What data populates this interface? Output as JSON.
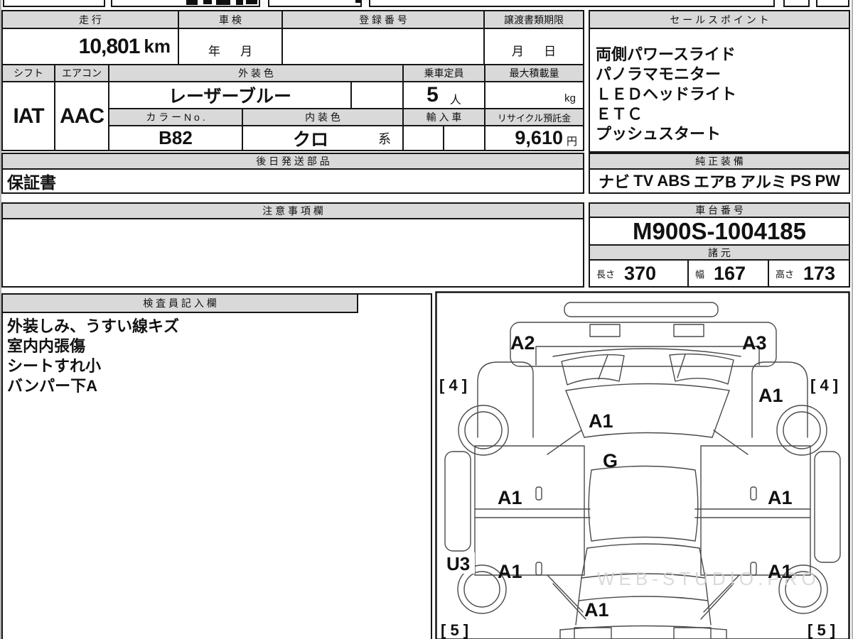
{
  "colors": {
    "header_fill": "#d9d9d9",
    "border": "#161616",
    "watermark_gray": "#d2d2d2"
  },
  "header_row": {
    "mileage_label": "走 行",
    "mileage_value": "10,801",
    "mileage_unit": "km",
    "shaken_label": "車 検",
    "shaken_value": "年      月",
    "registration_label": "登 録 番 号",
    "registration_value": "",
    "transfer_label": "譲渡書類期限",
    "transfer_value": "月      日"
  },
  "spec": {
    "shift_label": "シフト",
    "shift_value": "IAT",
    "aircon_label": "エアコン",
    "aircon_value": "AAC",
    "exterior_color_label": "外 装 色",
    "exterior_color_value": "レーザーブルー",
    "capacity_label": "乗車定員",
    "capacity_value": "5",
    "capacity_unit": "人",
    "max_load_label": "最大積載量",
    "max_load_unit": "kg",
    "color_no_label": "カ ラ ー N o .",
    "color_no_value": "B82",
    "interior_color_label": "内 装 色",
    "interior_color_value": "クロ",
    "interior_color_suffix": "系",
    "import_label": "輸 入 車",
    "recycle_label": "リサイクル預託金",
    "recycle_value": "9,610",
    "recycle_unit": "円"
  },
  "later_parts": {
    "label": "後 日 発 送 部 品",
    "value": "保証書"
  },
  "sales_points": {
    "label": "セ ー ル ス ポ イ ン ト",
    "items": [
      "両側パワースライド",
      "パノラマモニター",
      "ＬＥＤヘッドライト",
      "ＥＴＣ",
      "プッシュスタート"
    ]
  },
  "genuine_equipment": {
    "label": "純 正 装 備",
    "items": [
      "ナビ",
      "TV",
      "ABS",
      "エアB",
      "アルミ",
      "PS",
      "PW"
    ]
  },
  "notes": {
    "label": "注 意 事 項 欄",
    "value": ""
  },
  "chassis": {
    "label": "車 台 番 号",
    "value": "M900S-1004185"
  },
  "dimensions": {
    "label": "諸 元",
    "length_label": "長さ",
    "length_value": "370",
    "width_label": "幅",
    "width_value": "167",
    "height_label": "高さ",
    "height_value": "173"
  },
  "inspector_notes": {
    "label": "検 査 員 記 入 欄",
    "lines": [
      "外装しみ、うすい線キズ",
      "室内内張傷",
      "シートすれ小",
      "バンパー下A"
    ]
  },
  "diagram": {
    "watermark": "WEB-STUDIO.PRO",
    "labels": {
      "front_bumper_left": "A2",
      "front_bumper_right": "A3",
      "tire_front_left": "[ 4 ]",
      "tire_front_right": "[ 4 ]",
      "tire_rear_left": "[ 5 ]",
      "tire_rear_right": "[ 5 ]",
      "fender_front_right": "A1",
      "hood": "A1",
      "windshield": "G",
      "door_front_left": "A1",
      "door_front_right": "A1",
      "door_rear_left": "A1",
      "door_rear_right": "A1",
      "sill_left": "U3",
      "rear_gate": "A1"
    }
  }
}
